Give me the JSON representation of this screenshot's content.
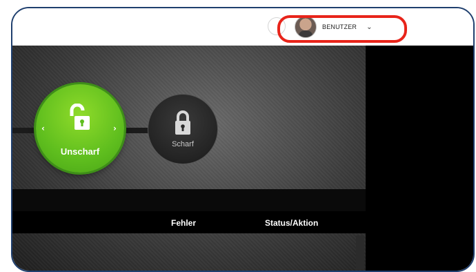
{
  "header": {
    "user_name": "BENUTZER",
    "help_icon": "chevron-right-icon",
    "user_caret": "chevron-down-icon"
  },
  "modes": [
    {
      "label": "Unscharf",
      "icon": "unlocked-padlock-icon",
      "active": true,
      "color": "#5fbe1e"
    },
    {
      "label": "Scharf",
      "icon": "locked-padlock-icon",
      "active": false,
      "color": "#232323"
    }
  ],
  "table": {
    "columns": [
      "Fehler",
      "Status/Aktion"
    ]
  },
  "colors": {
    "highlight": "#e8241a",
    "frame_border": "#1f3f6e",
    "active_green": "#5fbe1e"
  }
}
